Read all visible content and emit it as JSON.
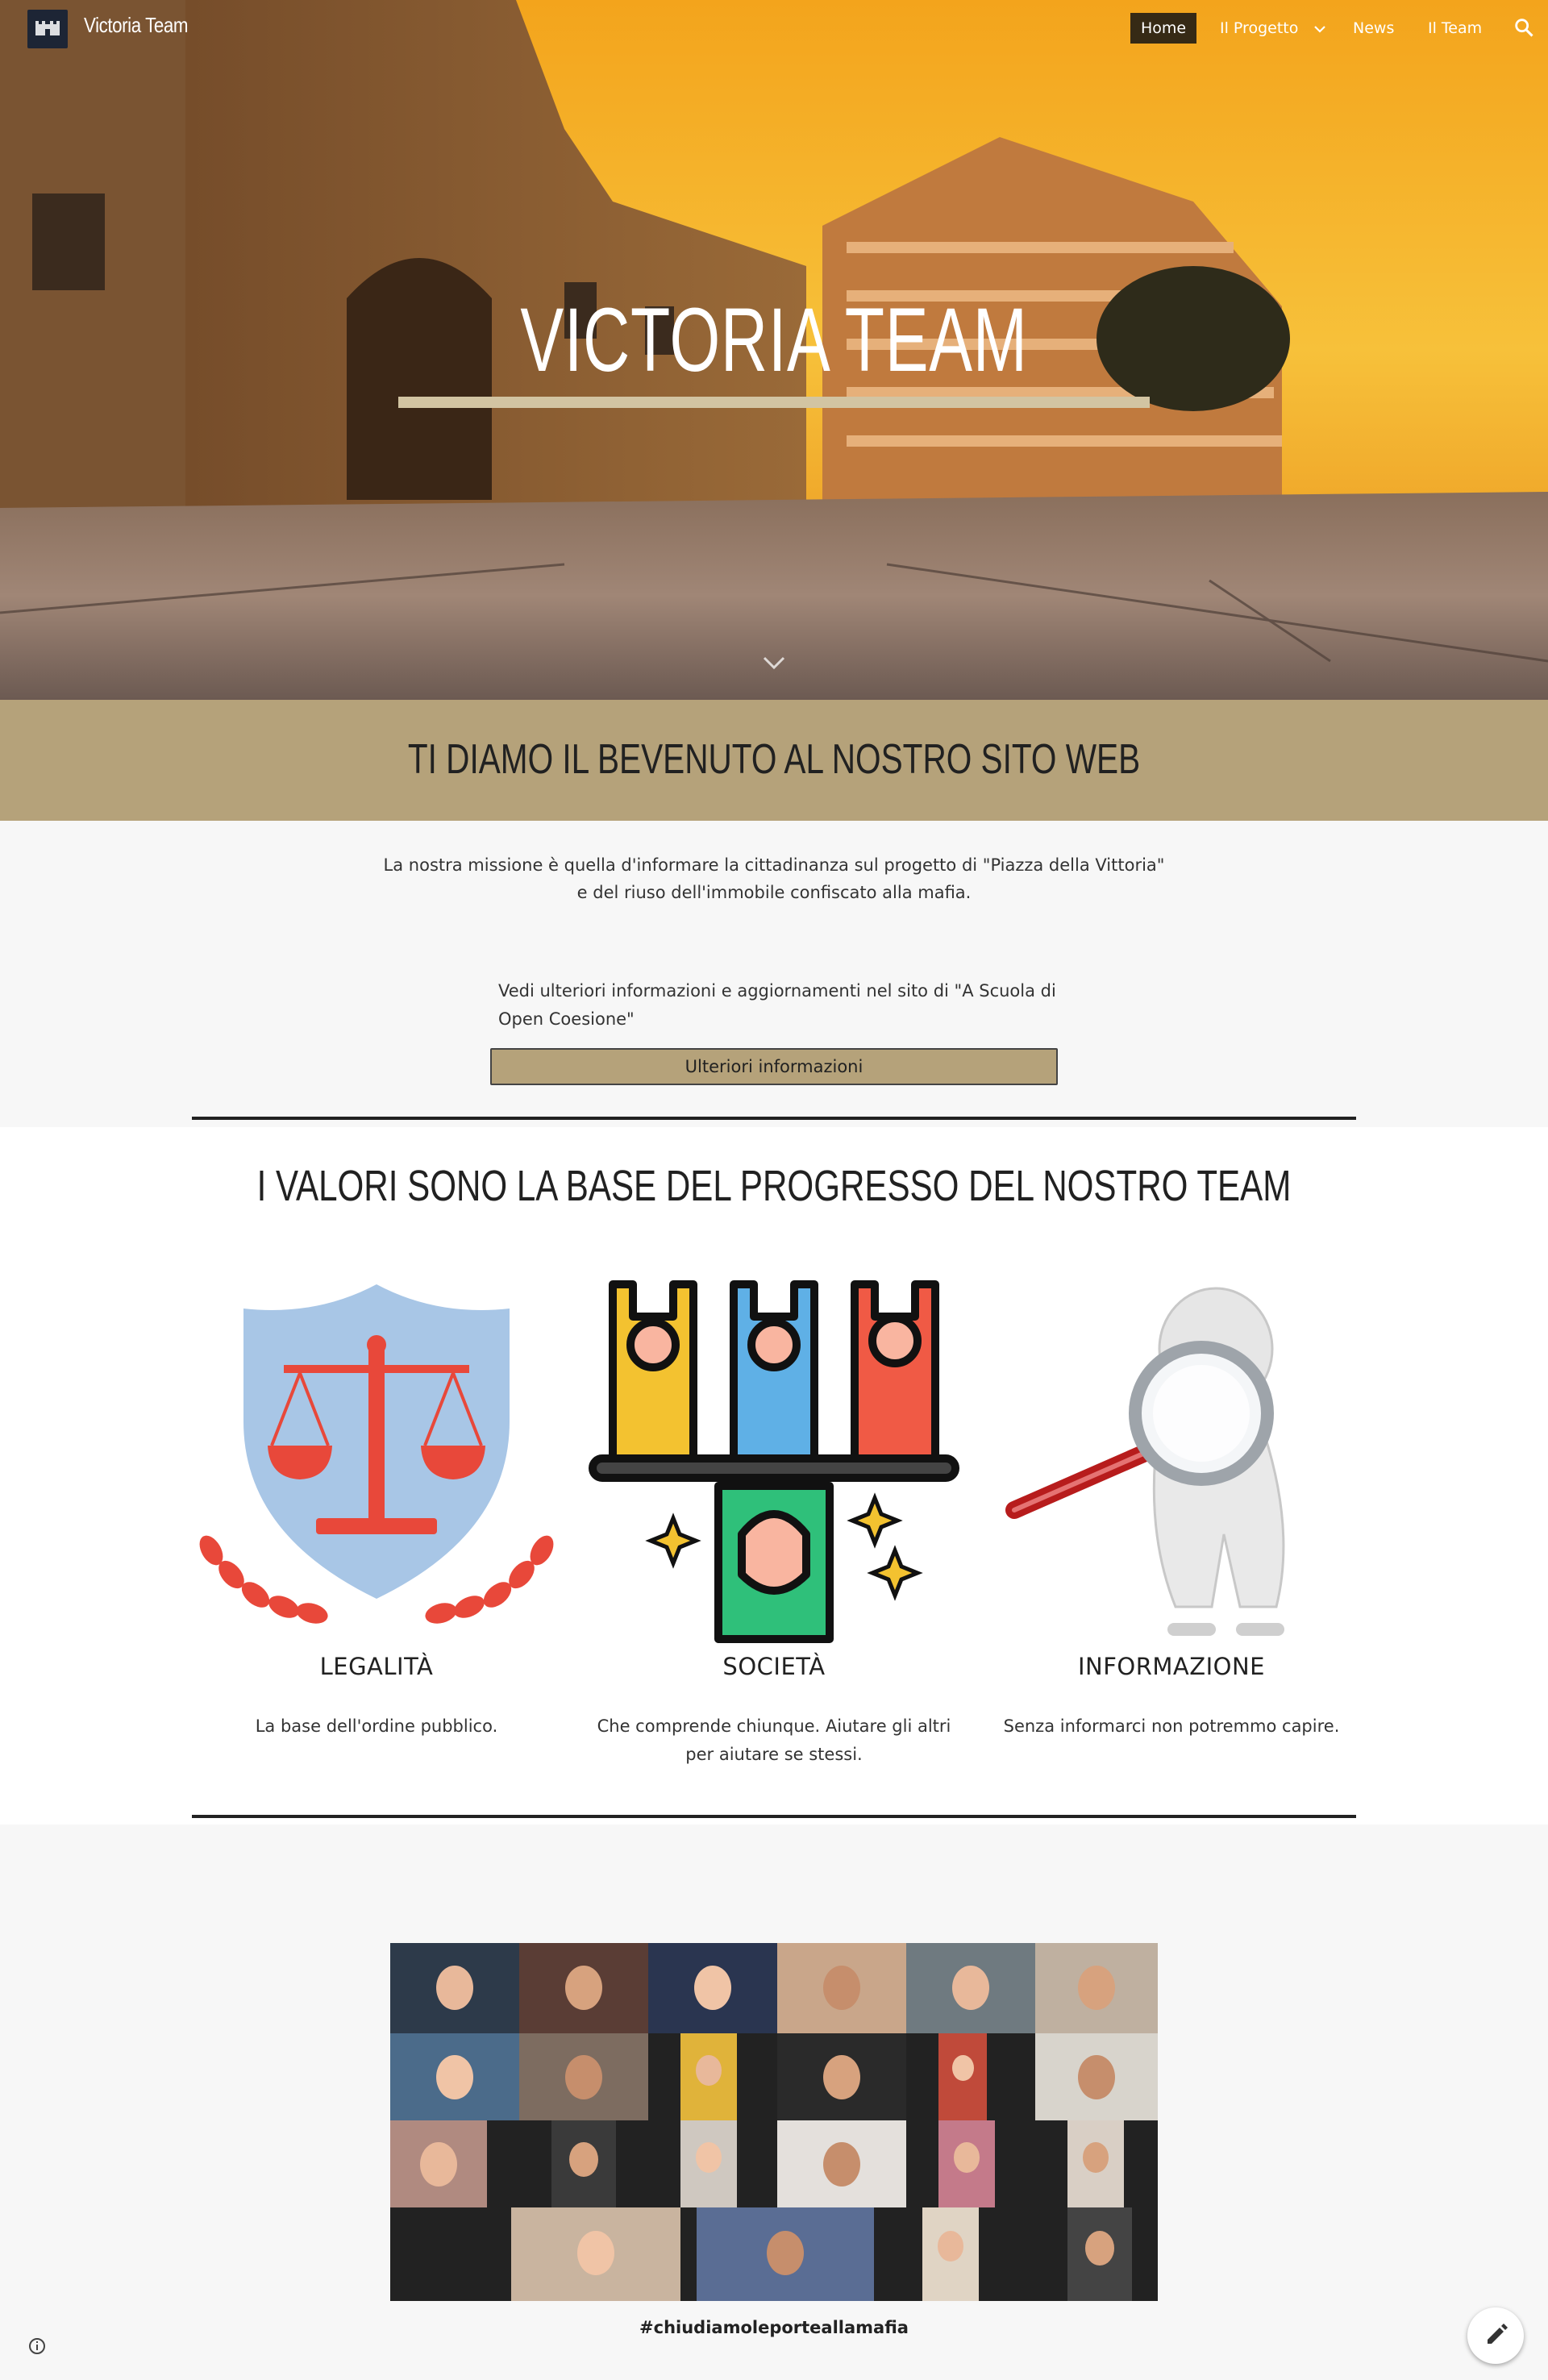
{
  "nav": {
    "site_title": "Victoria Team",
    "items": [
      {
        "label": "Home",
        "active": true
      },
      {
        "label": "Il Progetto",
        "active": false
      },
      {
        "label": "News",
        "active": false
      },
      {
        "label": "Il Team",
        "active": false
      }
    ],
    "icons": {
      "search": "search-icon",
      "dropdown": "chevron-down-icon"
    }
  },
  "hero": {
    "title": "VICTORIA TEAM",
    "scroll_icon": "chevron-down-icon"
  },
  "welcome": {
    "title": "TI DIAMO IL BEVENUTO AL NOSTRO SITO WEB"
  },
  "mission": {
    "line1": "La nostra missione è quella d'informare la cittadinanza sul progetto di \"Piazza della Vittoria\"",
    "line2": "e del riuso dell'immobile confiscato alla mafia.",
    "more_text": "Vedi ulteriori informazioni e aggiornamenti nel sito di \"A Scuola di Open Coesione\"",
    "button_label": "Ulteriori informazioni"
  },
  "values": {
    "title": "I VALORI SONO LA BASE DEL PROGRESSO DEL NOSTRO TEAM",
    "items": [
      {
        "name": "LEGALITÀ",
        "desc": "La base dell'ordine pubblico.",
        "icon": "scales-of-justice-icon"
      },
      {
        "name": "SOCIETÀ",
        "desc": "Che comprende chiunque. Aiutare gli altri per aiutare se stessi.",
        "icon": "people-together-icon"
      },
      {
        "name": "INFORMAZIONE",
        "desc": "Senza informarci non potremmo capire.",
        "icon": "magnifying-glass-icon"
      }
    ]
  },
  "photo": {
    "caption": "#chiudiamoleporteallamafia"
  },
  "footer": {
    "info_icon": "info-icon",
    "edit_icon": "pencil-icon"
  },
  "colors": {
    "accent": "#b5a27a",
    "hero_bar": "#d2c4a2",
    "nav_active_bg": "#141414"
  }
}
